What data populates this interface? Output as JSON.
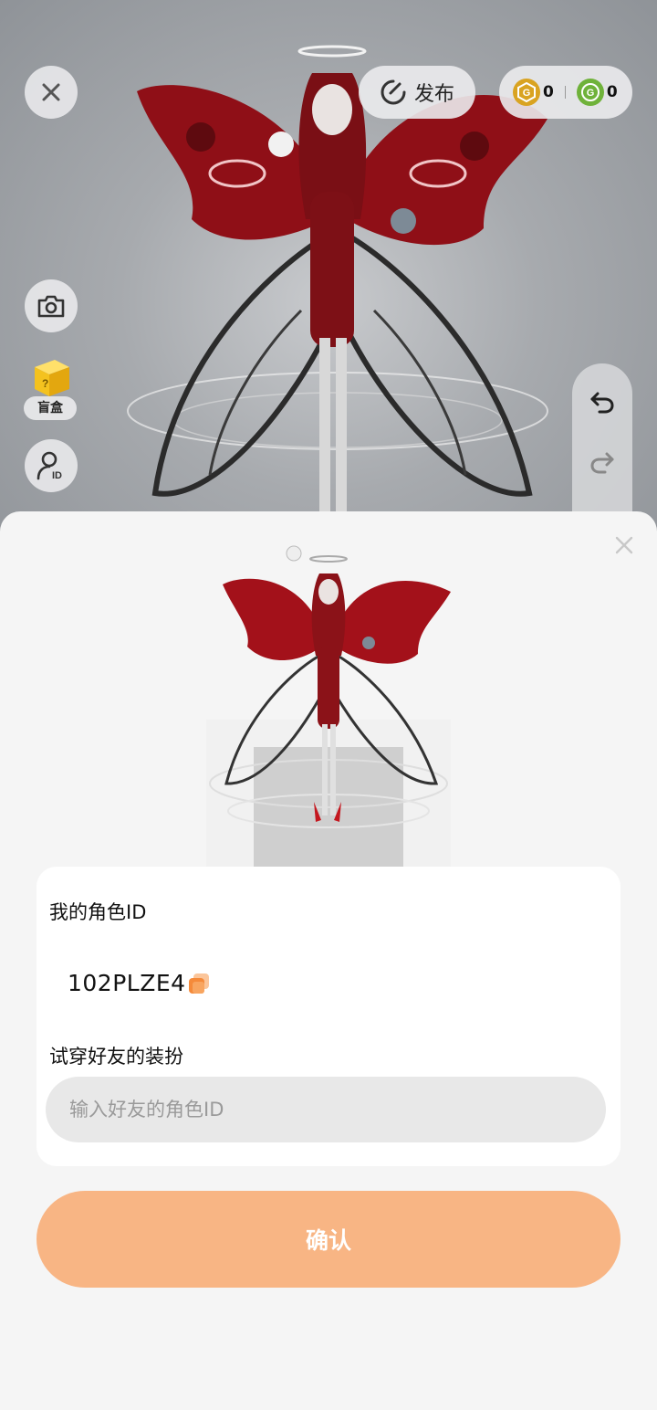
{
  "toolbar": {
    "publish_label": "发布",
    "coin_gold_count": "0",
    "coin_green_count": "0",
    "blindbox_label": "盲盒"
  },
  "colors": {
    "accent": "#f8b584",
    "sheet_bg": "#f5f5f5",
    "wing_red": "#a3111a",
    "coin_gold": "#d9a321",
    "coin_green": "#6fb23a"
  },
  "icons": [
    "close-icon",
    "publish-icon",
    "gold-coin-icon",
    "green-coin-icon",
    "camera-icon",
    "blindbox-icon",
    "profile-id-icon",
    "undo-icon",
    "redo-icon",
    "sheet-close-icon",
    "copy-icon"
  ],
  "sheet": {
    "role_id_title": "我的角色ID",
    "role_id_value": "102PLZE4",
    "try_on_title": "试穿好友的装扮",
    "friend_id_placeholder": "输入好友的角色ID",
    "friend_id_value": "",
    "confirm_label": "确认"
  }
}
